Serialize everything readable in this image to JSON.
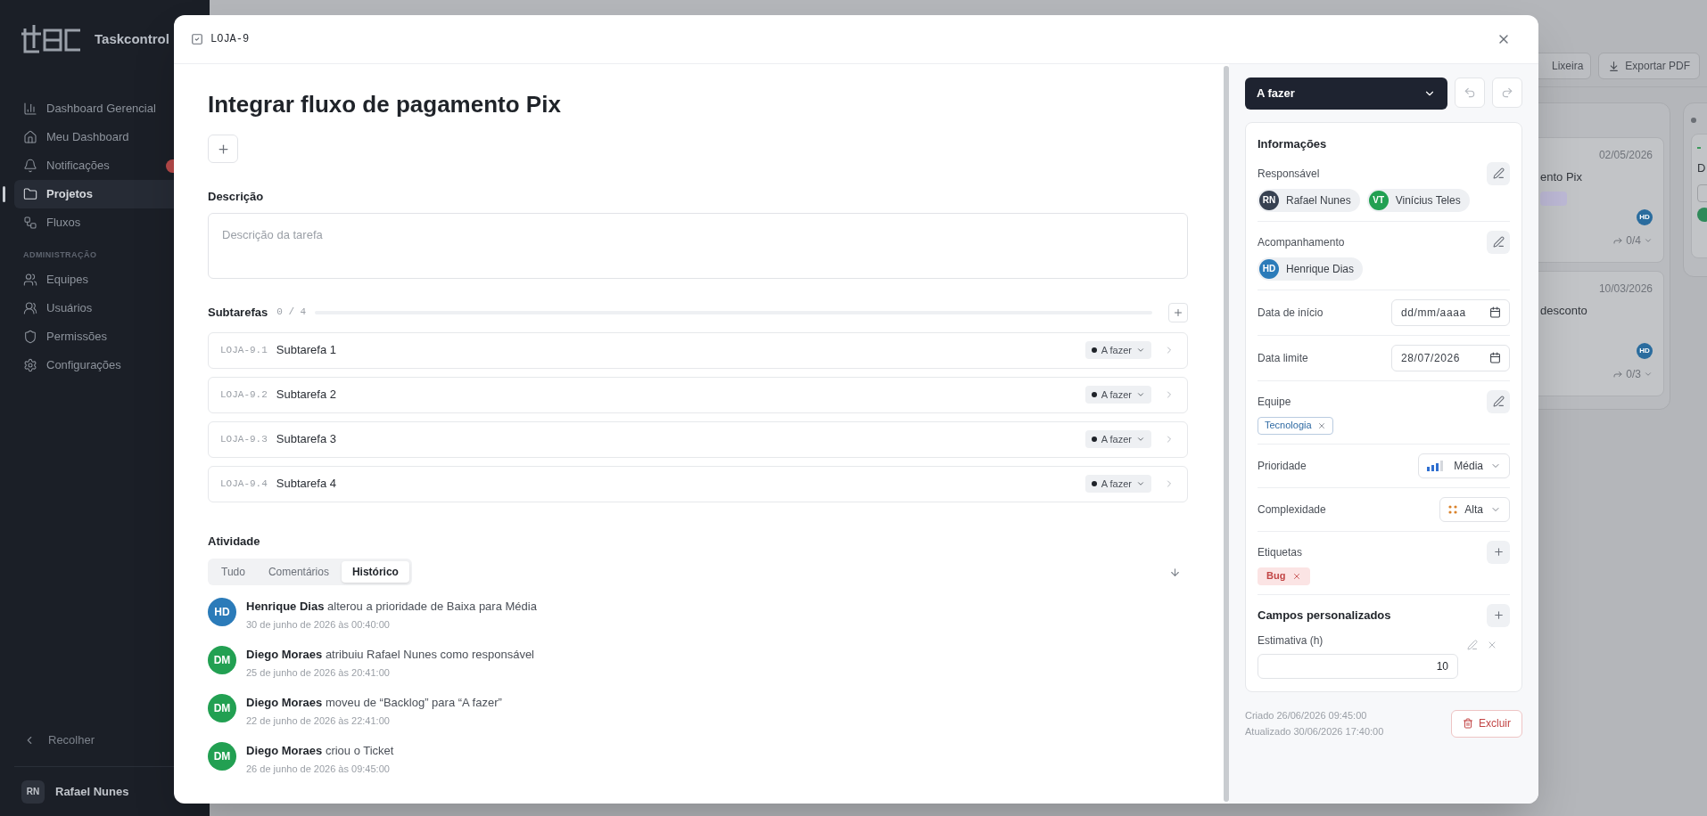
{
  "sidebar": {
    "brand": "Taskcontrol",
    "nav": [
      {
        "label": "Dashboard Gerencial",
        "selected": false,
        "has_badge": false
      },
      {
        "label": "Meu Dashboard",
        "selected": false,
        "has_badge": false
      },
      {
        "label": "Notificações",
        "selected": false,
        "has_badge": true
      },
      {
        "label": "Projetos",
        "selected": true,
        "has_badge": false
      },
      {
        "label": "Fluxos",
        "selected": false,
        "has_badge": false
      }
    ],
    "section_label": "ADMINISTRAÇÃO",
    "admin_nav": [
      {
        "label": "Equipes",
        "selected": false
      },
      {
        "label": "Usuários",
        "selected": false
      },
      {
        "label": "Permissões",
        "selected": false
      },
      {
        "label": "Configurações",
        "selected": false
      }
    ],
    "collapse": "Recolher",
    "user": {
      "initials": "RN",
      "name": "Rafael Nunes"
    }
  },
  "background": {
    "toolbar_buttons": [
      {
        "label": "Lixeira"
      },
      {
        "label": "Exportar PDF"
      }
    ],
    "cards": [
      {
        "date": "02/05/2026",
        "title": "ento Pix",
        "has_tag": true,
        "assignee": "HD",
        "subtasks": "0/4"
      },
      {
        "date": "10/03/2026",
        "title": "desconto",
        "has_tag": false,
        "assignee": "HD",
        "subtasks": "0/3"
      }
    ],
    "next_column_card": {
      "title": "D"
    }
  },
  "modal": {
    "ticket_id": "LOJA-9",
    "title": "Integrar fluxo de pagamento Pix",
    "description": {
      "label": "Descrição",
      "placeholder": "Descrição da tarefa"
    },
    "subtasks": {
      "label": "Subtarefas",
      "count": "0 / 4",
      "level": 0,
      "items": [
        {
          "id": "LOJA-9.1",
          "title": "Subtarefa 1",
          "status": "A fazer"
        },
        {
          "id": "LOJA-9.2",
          "title": "Subtarefa 2",
          "status": "A fazer"
        },
        {
          "id": "LOJA-9.3",
          "title": "Subtarefa 3",
          "status": "A fazer"
        },
        {
          "id": "LOJA-9.4",
          "title": "Subtarefa 4",
          "status": "A fazer"
        }
      ]
    },
    "activity": {
      "label": "Atividade",
      "tabs": [
        {
          "label": "Tudo",
          "selected": false
        },
        {
          "label": "Comentários",
          "selected": false
        },
        {
          "label": "Histórico",
          "selected": true
        }
      ],
      "entries": [
        {
          "initials": "HD",
          "color": "#2b7bb9",
          "user": "Henrique Dias",
          "action": "alterou a prioridade de Baixa para Média",
          "time": "30 de junho de 2026 às 00:40:00"
        },
        {
          "initials": "DM",
          "color": "#22a052",
          "user": "Diego Moraes",
          "action": "atribuiu Rafael Nunes como responsável",
          "time": "25 de junho de 2026 às 20:41:00"
        },
        {
          "initials": "DM",
          "color": "#22a052",
          "user": "Diego Moraes",
          "action": "moveu de “Backlog” para “A fazer”",
          "time": "22 de junho de 2026 às 22:41:00"
        },
        {
          "initials": "DM",
          "color": "#22a052",
          "user": "Diego Moraes",
          "action": "criou o Ticket",
          "time": "26 de junho de 2026 às 09:45:00"
        }
      ]
    }
  },
  "details": {
    "status": "A fazer",
    "info_title": "Informações",
    "responsible": {
      "label": "Responsável",
      "people": [
        {
          "initials": "RN",
          "name": "Rafael Nunes",
          "color": "#374151"
        },
        {
          "initials": "VT",
          "name": "Vinícius Teles",
          "color": "#22a052"
        }
      ]
    },
    "followers": {
      "label": "Acompanhamento",
      "people": [
        {
          "initials": "HD",
          "name": "Henrique Dias",
          "color": "#2b7bb9"
        }
      ]
    },
    "start_date": {
      "label": "Data de início",
      "placeholder": "dd/mm/aaaa"
    },
    "due_date": {
      "label": "Data limite",
      "value": "28/07/2026"
    },
    "team": {
      "label": "Equipe",
      "tags": [
        "Tecnologia"
      ]
    },
    "priority": {
      "label": "Prioridade",
      "value": "Média"
    },
    "complexity": {
      "label": "Complexidade",
      "value": "Alta"
    },
    "labels": {
      "label": "Etiquetas",
      "tags": [
        "Bug"
      ]
    },
    "custom_fields": {
      "title": "Campos personalizados",
      "fields": [
        {
          "label": "Estimativa (h)",
          "value": "10"
        }
      ]
    },
    "created": "Criado 26/06/2026 09:45:00",
    "updated": "Atualizado 30/06/2026 17:40:00",
    "delete": "Excluir"
  }
}
